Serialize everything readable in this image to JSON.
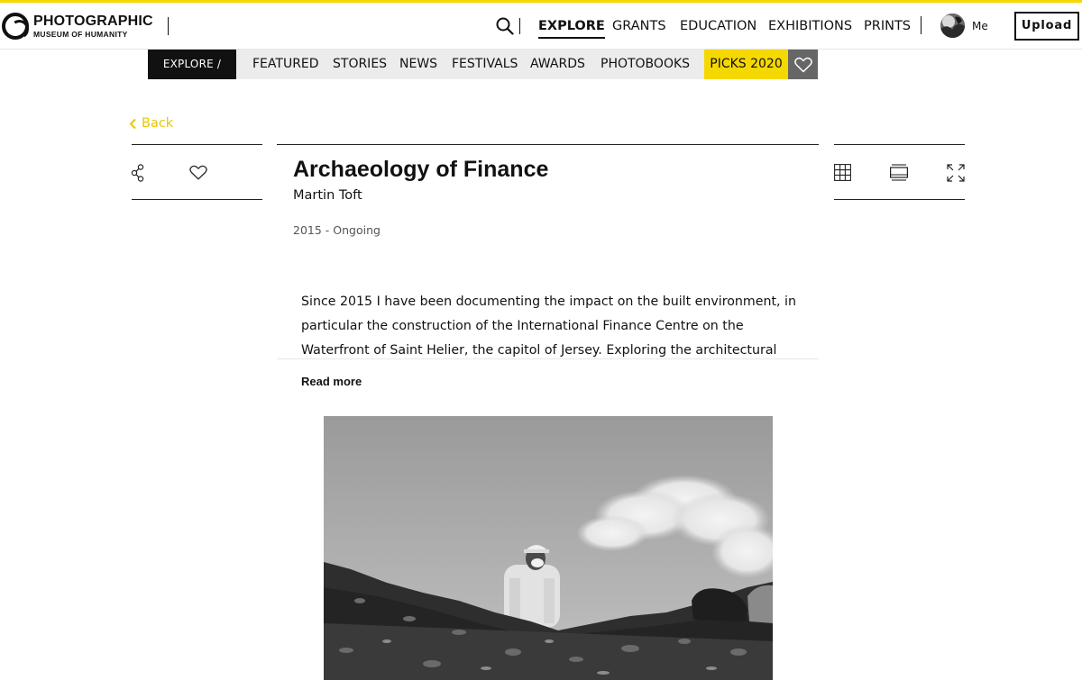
{
  "brand": {
    "name_line1": "PHOTOGRAPHIC",
    "name_line2": "MUSEUM OF HUMANITY",
    "accent_color": "#f5d800"
  },
  "header": {
    "search_icon": "search-icon",
    "nav": [
      {
        "label": "EXPLORE",
        "active": true
      },
      {
        "label": "GRANTS",
        "active": false
      },
      {
        "label": "EDUCATION",
        "active": false
      },
      {
        "label": "EXHIBITIONS",
        "active": false
      },
      {
        "label": "PRINTS",
        "active": false
      }
    ],
    "user_label": "Me",
    "upload_label": "Upload"
  },
  "subnav": {
    "root_label": "EXPLORE /",
    "items": [
      "FEATURED",
      "STORIES",
      "NEWS",
      "FESTIVALS",
      "AWARDS",
      "PHOTOBOOKS"
    ],
    "highlight_label": "PICKS 2020",
    "highlight_color": "#f5d800",
    "favorites_icon": "heart-icon"
  },
  "back_label": "Back",
  "toolbar": {
    "left_icons": [
      "share-icon",
      "heart-icon"
    ],
    "right_icons": [
      "grid-view-icon",
      "slideshow-view-icon",
      "fullscreen-icon"
    ]
  },
  "project": {
    "title": "Archaeology of Finance",
    "author": "Martin Toft",
    "dates": "2015 - Ongoing",
    "description": "Since 2015 I have been documenting the impact on the built environment, in particular the construction of the International Finance Centre on the Waterfront of Saint Helier, the capitol of Jersey. Exploring the architectural exterior with the",
    "read_more_label": "Read more"
  }
}
